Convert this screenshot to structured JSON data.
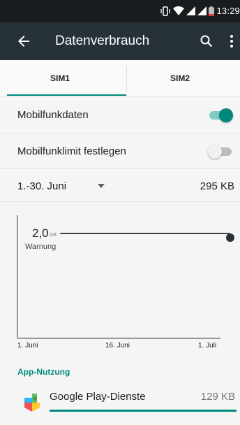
{
  "status_bar": {
    "time": "13:29"
  },
  "app_bar": {
    "title": "Datenverbrauch",
    "icons": [
      "arrow-back-icon",
      "search-icon",
      "more-vert-icon"
    ]
  },
  "tabs": [
    {
      "label": "SIM1",
      "selected": true
    },
    {
      "label": "SIM2",
      "selected": false
    }
  ],
  "settings": {
    "mobile_data": {
      "label": "Mobilfunkdaten",
      "enabled": true
    },
    "mobile_limit": {
      "label": "Mobilfunklimit festlegen",
      "enabled": false
    }
  },
  "cycle": {
    "range": "1.-30. Juni",
    "total": "295 KB"
  },
  "chart": {
    "warning_value": "2,0",
    "warning_unit": "GB",
    "warning_label": "Warnung",
    "x_ticks": [
      "1. Juni",
      "16. Juni",
      "1. Juli"
    ]
  },
  "app_usage": {
    "header": "App-Nutzung",
    "items": [
      {
        "name": "Google Play-Dienste",
        "size": "129 KB",
        "icon": "google-play-services-icon"
      }
    ]
  },
  "colors": {
    "accent": "#00897b",
    "app_bar": "#263238",
    "status_bar": "#181c1e"
  }
}
